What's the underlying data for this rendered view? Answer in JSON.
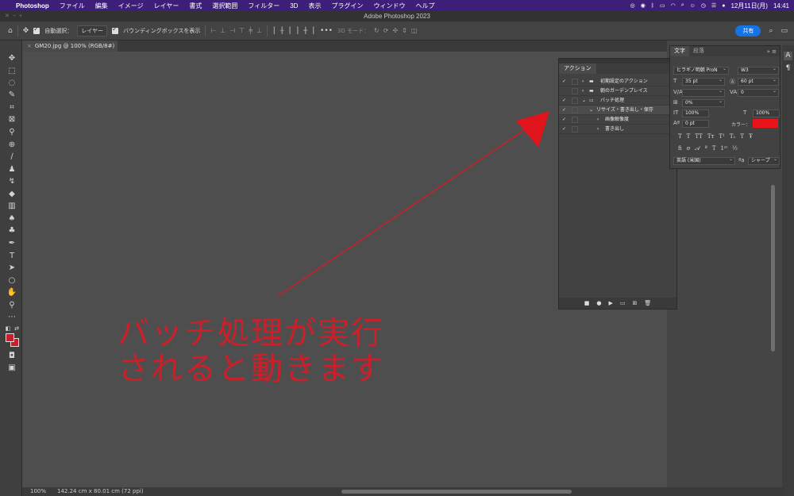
{
  "menubar": {
    "app": "Photoshop",
    "items": [
      "ファイル",
      "編集",
      "イメージ",
      "レイヤー",
      "書式",
      "選択範囲",
      "フィルター",
      "3D",
      "表示",
      "プラグイン",
      "ウィンドウ",
      "ヘルプ"
    ],
    "date": "12月11日(月)",
    "time": "14:41"
  },
  "titlebar": {
    "title": "Adobe Photoshop 2023"
  },
  "options": {
    "auto_select_label": "自動選択：",
    "layer_select": "レイヤー",
    "bbox_label": "バウンディングボックスを表示",
    "threed_label": "3D モード：",
    "share_label": "共有"
  },
  "document": {
    "tab_title": "GM20.jpg @ 100% (RGB/8#)",
    "zoom": "100%",
    "size_info": "142.24 cm x 80.01 cm (72 ppi)"
  },
  "annotation": {
    "line1": "バッチ処理が実行",
    "line2": "されると動きます"
  },
  "actions_panel": {
    "title": "アクション",
    "rows": [
      {
        "label": "初期設定のアクション",
        "checked": true
      },
      {
        "label": "朝のガーデンプレイス",
        "checked": false
      },
      {
        "label": "バッチ処理",
        "checked": true
      },
      {
        "label": "リサイズ・書き出し・保存",
        "checked": true
      },
      {
        "label": "画像解像度",
        "checked": true
      },
      {
        "label": "書き出し",
        "checked": true
      }
    ]
  },
  "character_panel": {
    "tab_character": "文字",
    "tab_paragraph": "段落",
    "font_family": "ヒラギノ明朝 ProN",
    "font_weight": "W3",
    "font_size": "35 pt",
    "leading": "60 pt",
    "tracking": "0",
    "tsume": "0%",
    "vscale": "100%",
    "hscale": "100%",
    "baseline": "0 pt",
    "color_label": "カラー：",
    "color": "#e8141a",
    "language": "英語 (米国)",
    "aa_mode": "シャープ"
  },
  "colors": {
    "foreground": "#c8202a",
    "annotation": "#cc1f2a",
    "share_button": "#1473e6"
  }
}
